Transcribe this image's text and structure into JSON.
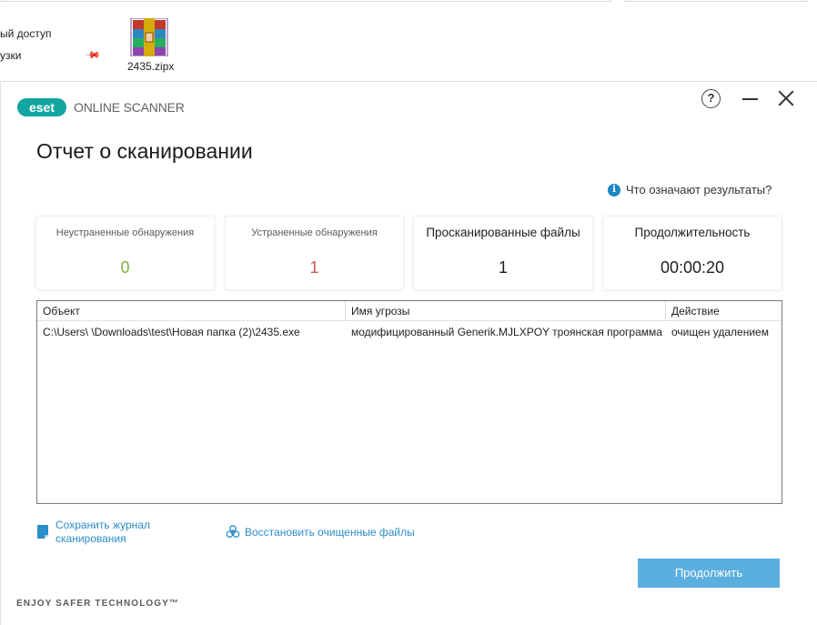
{
  "explorer": {
    "nav_items": [
      "ый доступ",
      "узки"
    ],
    "file_name": "2435.zipx"
  },
  "window": {
    "logo_text": "eset",
    "product_name": "ONLINE SCANNER",
    "help_glyph": "?",
    "title": "Отчет о сканировании",
    "help_link": "Что означают результаты?",
    "info_glyph": "i"
  },
  "stats": [
    {
      "label": "Неустраненные обнаружения",
      "value": "0",
      "color": "#7cb342"
    },
    {
      "label": "Устраненные обнаружения",
      "value": "1",
      "color": "#d9534f"
    },
    {
      "label": "Просканированные файлы",
      "value": "1",
      "color": "#1f1f1f"
    },
    {
      "label": "Продолжительность",
      "value": "00:00:20",
      "color": "#1f1f1f"
    }
  ],
  "table": {
    "headers": [
      "Объект",
      "Имя угрозы",
      "Действие"
    ],
    "rows": [
      {
        "object": "C:\\Users\\         \\Downloads\\test\\Новая папка (2)\\2435.exe",
        "threat": "модифицированный Generik.MJLXPOY троянская программа",
        "action": "очищен удалением"
      }
    ]
  },
  "links": {
    "save_log": "Сохранить журнал сканирования",
    "restore": "Восстановить очищенные файлы"
  },
  "buttons": {
    "continue": "Продолжить"
  },
  "tagline": "ENJOY SAFER TECHNOLOGY™",
  "colors": {
    "accent": "#2c8dc9",
    "button": "#5aaee0",
    "brand_teal": "#12a5a0"
  },
  "icons": [
    "winrar-archive-icon",
    "pin-icon",
    "eset-logo",
    "help-icon",
    "minimize-icon",
    "close-icon",
    "info-icon",
    "save-log-icon",
    "biohazard-restore-icon"
  ]
}
